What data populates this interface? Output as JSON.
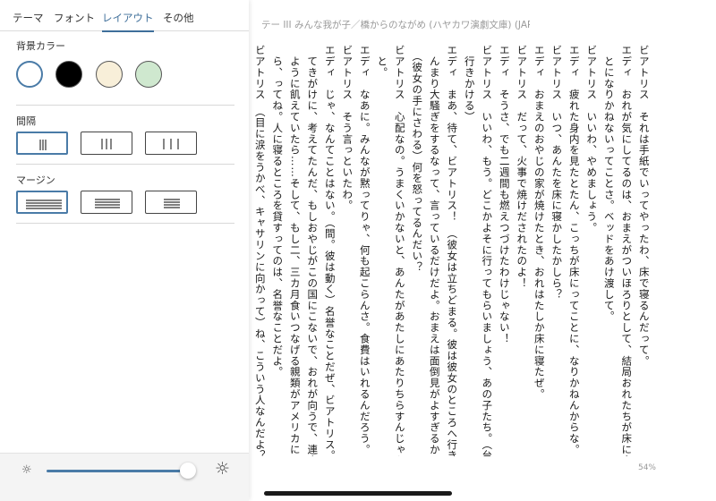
{
  "book": {
    "title": "テー III みんな我が子／橋からのながめ (ハヤカワ演劇文庫) (JAPANESE...",
    "progress": "54%",
    "columns": [
      "ビアトリス　それは手紙でいってやったわ、床で寝るんだって。",
      "エディ　おれが気にしてるのは、おまえがついほろりとして、結局おれたちが床に寝るこ",
      "　とになりかねないってことさ。ベッドをあけ渡して。",
      "ビアトリス　いいわ、やめましょう。",
      "エディ　疲れた身内を見たとたん、こっちが床にってことに、なりかねんからな。",
      "ビアトリス　いつ、あんたを床に寝かしたかしら？",
      "エディ　おまえのおやじの家が焼けたとき、おれはたしか床に寝たぜ。",
      "ビアトリス　だって、火事で焼けだされたのよ！",
      "エディ　そうさ、でも二週間も燃えつづけたわけじゃない！",
      "ビアトリス　いいわ、もう。どこかよそに行ってもらいましょう、あの子たち。（台所へ",
      "　行きかける）",
      "エディ　まあ、待て、ビアトリス！　（彼女は立ちどまる。彼は彼女のところへ行き）あ",
      "　んまり大騒ぎをするなって、言っているだけだよ。おまえは面倒見がよすぎるからね。",
      "　（彼女の手にさわる）何を怒ってるんだい？",
      "ビアトリス　心配なの。うまくいかないと、あんたがあたしにあたりちらすんじゃないか",
      "　と。",
      "エディ　なあに。みんなが黙ってりゃ、何も起こらんさ。食費はいれるんだろう。",
      "ビアトリス　そう言っといたわ。",
      "エディ　じゃ、なんてことはない。（間。彼は動く）名誉なことだぜ、ビアトリス。帰っ",
      "　てきがけに、考えてたんだ、もしおやじがこの国にこないで、おれが向うで、連中の",
      "　ように飢えていたら……そして、もし二、三カ月食いつなげる親類がアメリカにいた",
      "　ら、ってね。人に寝るところを貸すってのは、名誉なことだよ。",
      "ビアトリス　（目に涙をうかべ、キャサリンに向かって）ね、こういう人なんだよ？（振"
    ]
  },
  "panel": {
    "tabs": [
      {
        "label": "テーマ"
      },
      {
        "label": "フォント"
      },
      {
        "label": "レイアウト"
      },
      {
        "label": "その他"
      }
    ],
    "background_label": "背景カラー",
    "spacing_label": "間隔",
    "margin_label": "マージン",
    "swatches": [
      {
        "color": "#ffffff",
        "icon": "white-swatch"
      },
      {
        "color": "#000000",
        "icon": "black-swatch"
      },
      {
        "color": "#f8efd9",
        "icon": "sepia-swatch"
      },
      {
        "color": "#cfe8cf",
        "icon": "green-swatch"
      }
    ],
    "accent_color": "#4a7ba7",
    "brightness": 0.95
  }
}
